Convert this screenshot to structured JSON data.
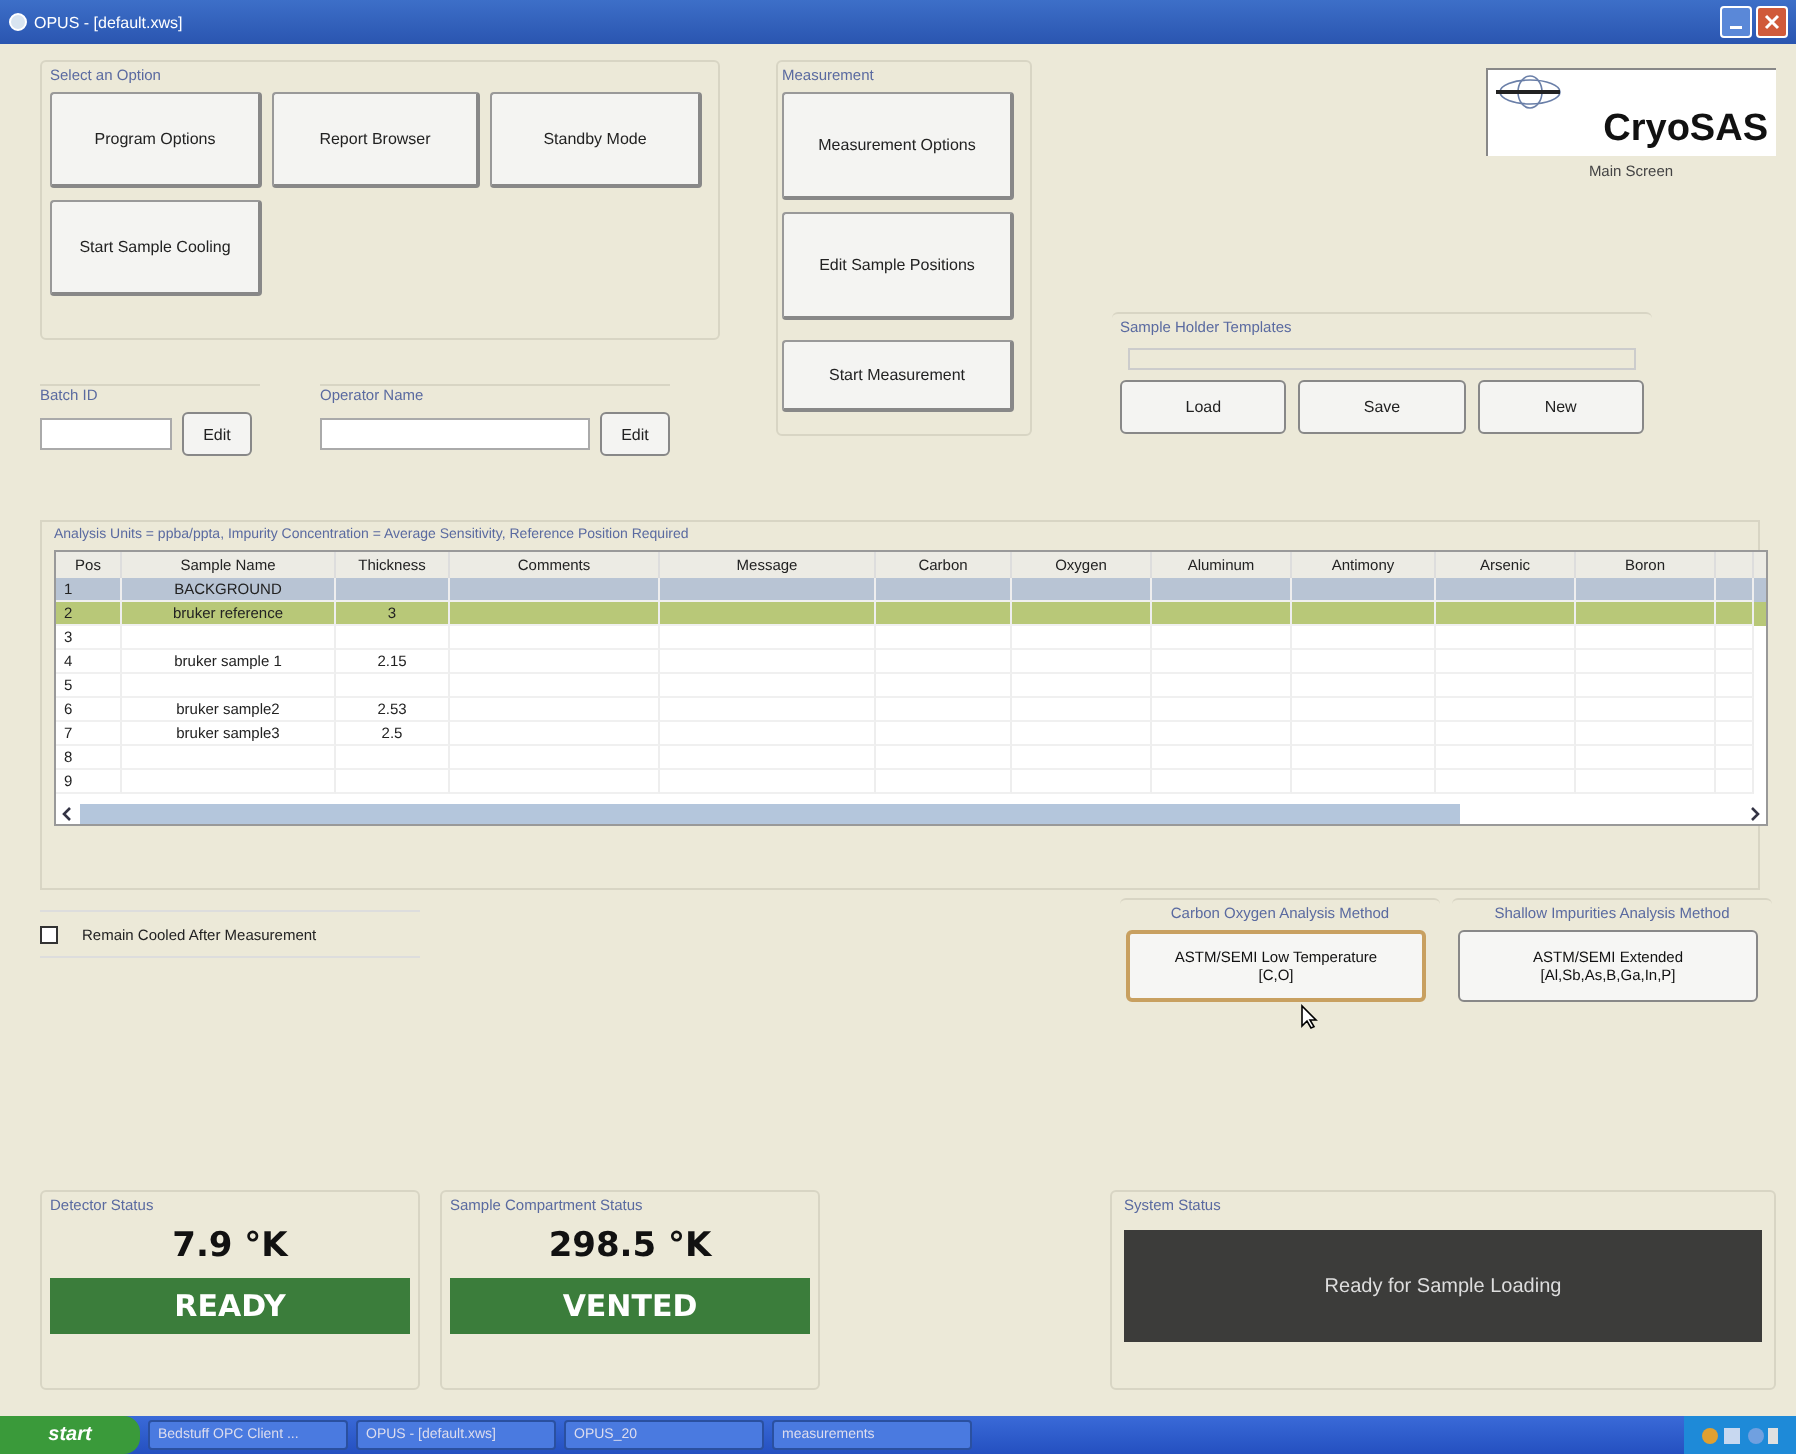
{
  "window": {
    "title": "OPUS - [default.xws]"
  },
  "option_group": {
    "title": "Select an Option",
    "buttons": [
      "Program Options",
      "Report Browser",
      "Standby Mode",
      "Start Sample Cooling"
    ]
  },
  "measurement_group": {
    "title": "Measurement",
    "buttons": [
      "Measurement Options",
      "Edit Sample Positions",
      "Start Measurement"
    ]
  },
  "logo": {
    "name": "CryoSAS",
    "subtitle": "Main Screen"
  },
  "batch": {
    "label": "Batch ID",
    "button": "Edit"
  },
  "operator": {
    "label": "Operator Name",
    "button": "Edit"
  },
  "templates": {
    "title": "Sample Holder Templates",
    "buttons": [
      "Load",
      "Save",
      "New"
    ]
  },
  "analysis_note": "Analysis Units = ppba/ppta, Impurity Concentration = Average Sensitivity, Reference Position Required",
  "table": {
    "columns": [
      "Pos",
      "Sample Name",
      "Thickness",
      "Comments",
      "Message",
      "Carbon",
      "Oxygen",
      "Aluminum",
      "Antimony",
      "Arsenic",
      "Boron"
    ],
    "rows": [
      {
        "kind": "background",
        "cells": [
          "1",
          "BACKGROUND",
          ""
        ]
      },
      {
        "kind": "reference",
        "cells": [
          "2",
          "bruker reference",
          "3"
        ]
      },
      {
        "kind": "plain",
        "cells": [
          "3",
          "",
          ""
        ]
      },
      {
        "kind": "plain",
        "cells": [
          "4",
          "bruker sample 1",
          "2.15"
        ]
      },
      {
        "kind": "plain",
        "cells": [
          "5",
          "",
          ""
        ]
      },
      {
        "kind": "plain",
        "cells": [
          "6",
          "bruker sample2",
          "2.53"
        ]
      },
      {
        "kind": "plain",
        "cells": [
          "7",
          "bruker sample3",
          "2.5"
        ]
      },
      {
        "kind": "plain",
        "cells": [
          "8",
          "",
          ""
        ]
      },
      {
        "kind": "plain",
        "cells": [
          "9",
          "",
          ""
        ]
      }
    ]
  },
  "remain_cooled": {
    "label": "Remain Cooled After Measurement",
    "checked": false
  },
  "methods": [
    {
      "title": "Carbon Oxygen Analysis Method",
      "button": "ASTM/SEMI Low Temperature\n[C,O]",
      "selected": true
    },
    {
      "title": "Shallow Impurities Analysis Method",
      "button": "ASTM/SEMI Extended\n[Al,Sb,As,B,Ga,In,P]",
      "selected": false
    }
  ],
  "statuses": [
    {
      "title": "Detector Status",
      "reading": "7.9 °K",
      "state": "READY",
      "color": "#3b7d3b"
    },
    {
      "title": "Sample Compartment Status",
      "reading": "298.5 °K",
      "state": "VENTED",
      "color": "#3b7d3b"
    }
  ],
  "system_status": {
    "title": "System Status",
    "message": "Ready for Sample Loading"
  },
  "taskbar": {
    "start": "start",
    "items": [
      "Bedstuff OPC Client ...",
      "OPUS - [default.xws]",
      "OPUS_20",
      "measurements"
    ]
  }
}
